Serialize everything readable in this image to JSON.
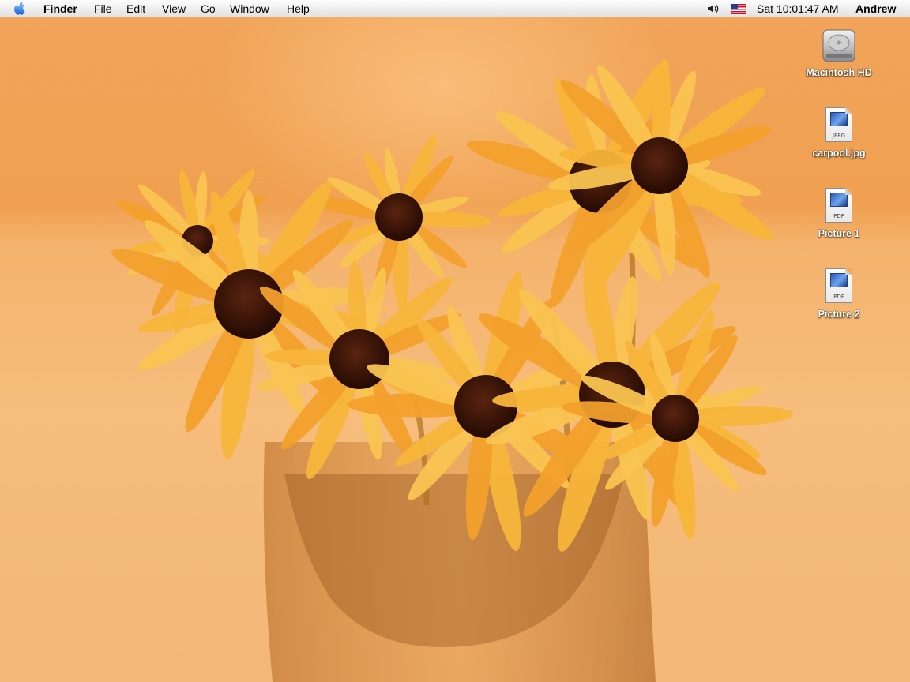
{
  "menubar": {
    "apple_icon": "apple-icon",
    "app_name": "Finder",
    "menus": [
      "File",
      "Edit",
      "View",
      "Go",
      "Window",
      "Help"
    ],
    "volume_icon": "volume-icon",
    "input_flag_icon": "us-flag-icon",
    "clock": "Sat 10:01:47 AM",
    "user": "Andrew"
  },
  "desktop": {
    "wallpaper": "orange-flowers-in-glass-vase",
    "icons": [
      {
        "label": "Macintosh HD",
        "icon": "hard-drive-icon"
      },
      {
        "label": "carpool.jpg",
        "icon": "jpeg-document-icon",
        "type": "JPEG"
      },
      {
        "label": "Picture 1",
        "icon": "pdf-document-icon",
        "type": "PDF"
      },
      {
        "label": "Picture 2",
        "icon": "pdf-document-icon",
        "type": "PDF"
      }
    ]
  },
  "colors": {
    "wallpaper_base": "#f0a24a",
    "petal": "#f7b53a",
    "flower_center": "#3a1406",
    "menubar": "#eeeeee"
  }
}
